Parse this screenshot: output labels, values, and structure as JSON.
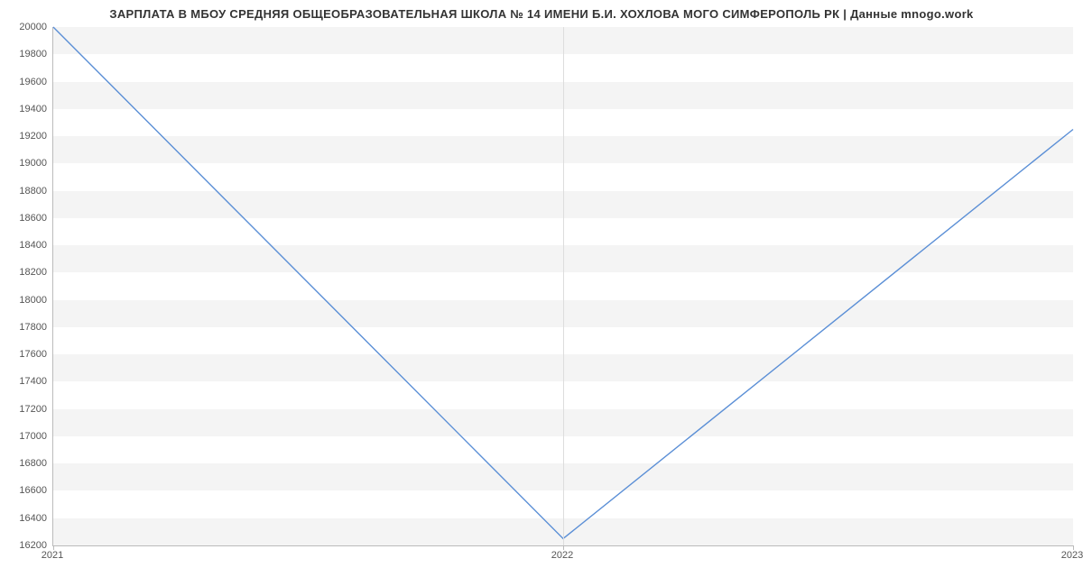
{
  "chart_data": {
    "type": "line",
    "title": "ЗАРПЛАТА В МБОУ СРЕДНЯЯ ОБЩЕОБРАЗОВАТЕЛЬНАЯ ШКОЛА № 14 ИМЕНИ Б.И. ХОХЛОВА МОГО СИМФЕРОПОЛЬ РК | Данные mnogo.work",
    "x": [
      2021,
      2022,
      2023
    ],
    "values": [
      20000,
      16250,
      19250
    ],
    "xlabel": "",
    "ylabel": "",
    "ylim": [
      16200,
      20000
    ],
    "y_ticks": [
      16200,
      16400,
      16600,
      16800,
      17000,
      17200,
      17400,
      17600,
      17800,
      18000,
      18200,
      18400,
      18600,
      18800,
      19000,
      19200,
      19400,
      19600,
      19800,
      20000
    ],
    "x_ticks": [
      2021,
      2022,
      2023
    ],
    "line_color": "#5b8fd6"
  }
}
